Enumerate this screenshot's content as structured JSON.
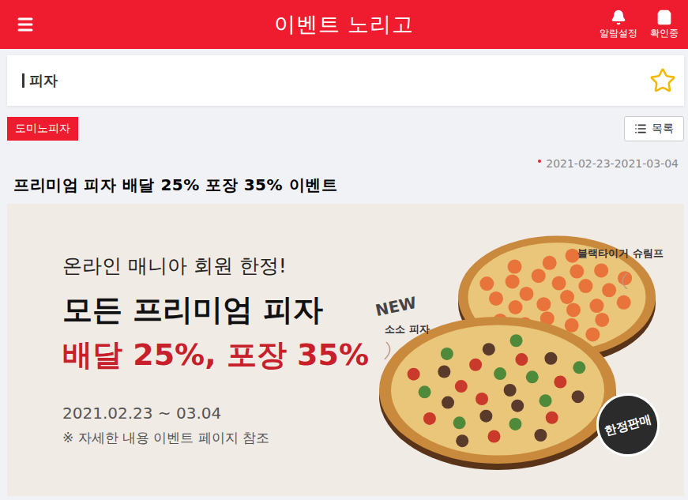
{
  "header": {
    "title": "이벤트 노리고",
    "actions": [
      {
        "label": "알람설정",
        "kind": "bell"
      },
      {
        "label": "확인중",
        "kind": "bag"
      }
    ]
  },
  "category": {
    "title": "피자",
    "favorited": false
  },
  "tag": "도미노피자",
  "list_button": "목록",
  "period": "2021-02-23-2021-03-04",
  "post_title": "프리미엄 피자 배달 25% 포장 35% 이벤트",
  "banner": {
    "kicker": "온라인 매니아 회원 한정!",
    "headline": "모든 프리미엄 피자",
    "offer": "배달 25%, 포장 35%",
    "dates": "2021.02.23 ~ 03.04",
    "note": "※ 자세한 내용 이벤트 페이지 참조",
    "labels": {
      "shrimp": "블랙타이거 슈림프",
      "new": "NEW",
      "soso": "소소 피자",
      "stamp": "한정판매"
    }
  }
}
